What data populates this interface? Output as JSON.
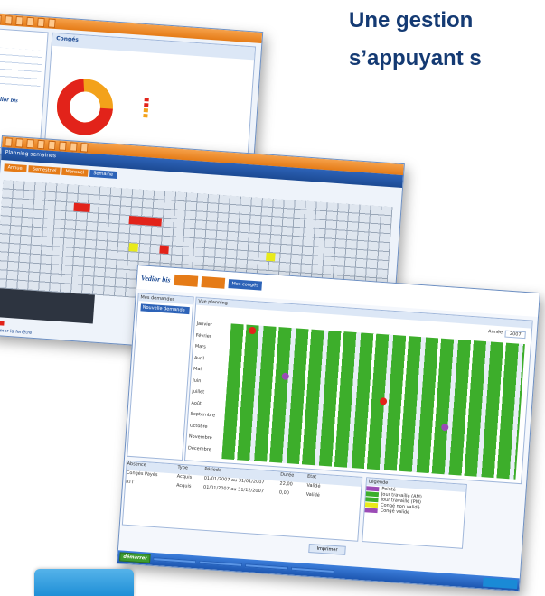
{
  "headline": {
    "line1": "Une gestion",
    "line2": "s’appuyant s"
  },
  "window1": {
    "title": "Congés",
    "nav_tabs": [
      "",
      "",
      "",
      "",
      "",
      "",
      "",
      ""
    ],
    "logo": "Vedior bis",
    "legend": [
      "",
      "",
      "",
      ""
    ],
    "donut_colors": [
      "#e2231a",
      "#f3a21a",
      "#ffffff"
    ]
  },
  "window2": {
    "title": "Planning semaines",
    "tabs": [
      "Annuel",
      "Semestriel",
      "Mensuel",
      "Semaine"
    ],
    "legend": [
      "",
      ""
    ],
    "footer": "Fermer la fenêtre"
  },
  "window3": {
    "logo": "Vedior bis",
    "nav": [
      "",
      "",
      "Mes congés",
      "",
      ""
    ],
    "sidebar_title": "Mes demandes",
    "sidebar_button": "Nouvelle demande",
    "calendar_title": "Vue planning",
    "months": [
      "Janvier",
      "Février",
      "Mars",
      "Avril",
      "Mai",
      "Juin",
      "Juillet",
      "Août",
      "Septembre",
      "Octobre",
      "Novembre",
      "Décembre"
    ],
    "year_label": "Année",
    "year_value": "2007",
    "table_headers": [
      "Absence",
      "Type",
      "Période",
      "Durée",
      "",
      "",
      "",
      "Etat"
    ],
    "rows": [
      [
        "Congés Payés",
        "Acquis",
        "01/01/2007 au 31/01/2007",
        "22,00",
        "",
        "",
        "",
        "Validé"
      ],
      [
        "RTT",
        "Acquis",
        "01/01/2007 au 31/12/2007",
        "0,00",
        "",
        "",
        "",
        "Validé"
      ]
    ],
    "legend_title": "Légende",
    "legend_items": [
      "Pointé",
      "Jour travaillé (AM)",
      "Jour travaillé (PM)",
      "Congé non validé",
      "Congé validé"
    ],
    "bottom_button": "Imprimer",
    "taskbar_start": "démarrer",
    "taskbar_items": [
      "",
      "",
      "",
      ""
    ],
    "tray_time": ""
  },
  "colors": {
    "nav_orange": "#e57b17",
    "title_blue": "#1c4a93",
    "green": "#3dae2b",
    "red": "#e2231a",
    "purple": "#9b4bb6"
  }
}
